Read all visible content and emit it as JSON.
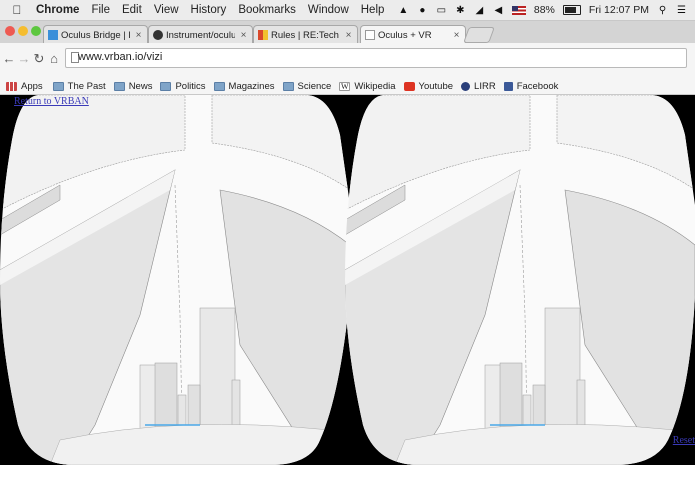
{
  "menubar": {
    "app_name": "Chrome",
    "menus": [
      "File",
      "Edit",
      "View",
      "History",
      "Bookmarks",
      "Window",
      "Help"
    ],
    "battery": "88%",
    "clock": "Fri 12:07 PM"
  },
  "tabs": [
    {
      "title": "Oculus Bridge | Labs | Inst",
      "favicon_color": "#3b8fd9"
    },
    {
      "title": "Instrument/oculus-bridge",
      "favicon_color": "#333333"
    },
    {
      "title": "Rules | RE:Tech – NYC Rea",
      "favicon_color": "#d9482b"
    },
    {
      "title": "Oculus + VR",
      "favicon_color": "#ffffff"
    }
  ],
  "toolbar": {
    "url": "www.vrban.io/vizi"
  },
  "bookmarks": [
    {
      "label": "Apps",
      "icon": "apps-grid-icon"
    },
    {
      "label": "The Past",
      "icon": "folder-icon"
    },
    {
      "label": "News",
      "icon": "folder-icon"
    },
    {
      "label": "Politics",
      "icon": "folder-icon"
    },
    {
      "label": "Magazines",
      "icon": "folder-icon"
    },
    {
      "label": "Science",
      "icon": "folder-icon"
    },
    {
      "label": "Wikipedia",
      "icon": "wikipedia-icon"
    },
    {
      "label": "Youtube",
      "icon": "youtube-icon"
    },
    {
      "label": "LIRR",
      "icon": "lirr-icon"
    },
    {
      "label": "Facebook",
      "icon": "facebook-icon"
    }
  ],
  "page": {
    "return_link": "Return to VRBAN",
    "corner_link": "Reset"
  }
}
